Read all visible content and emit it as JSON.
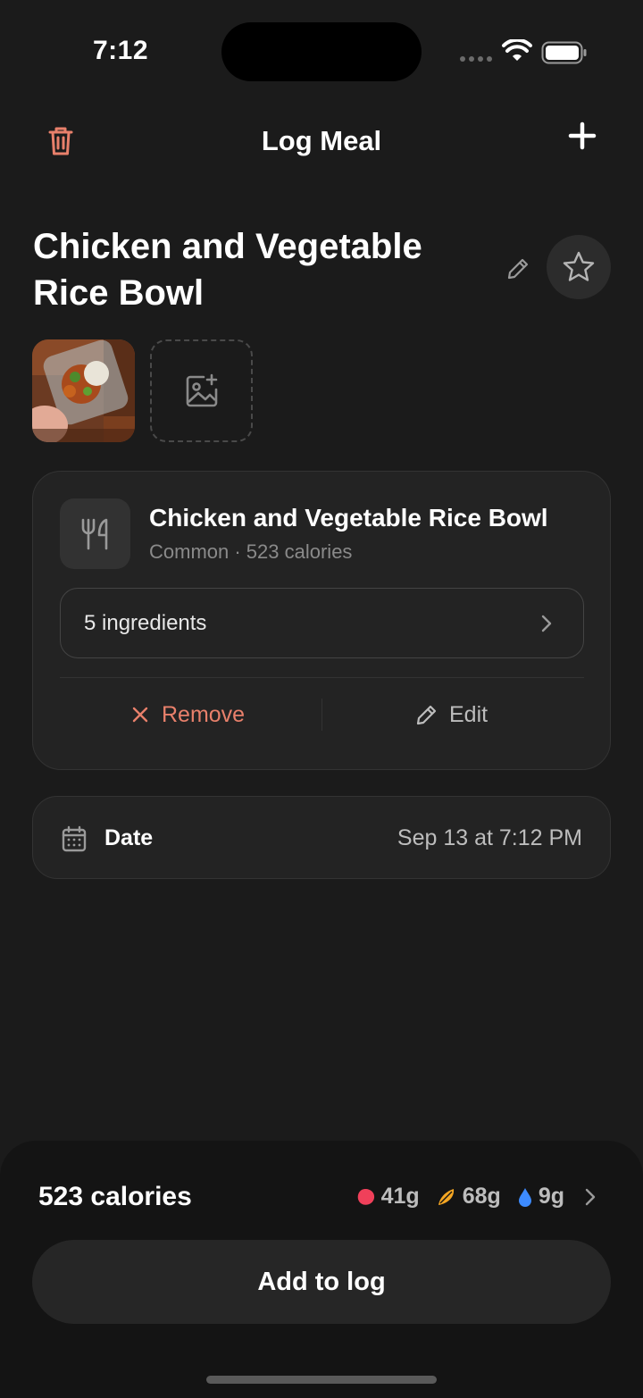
{
  "status_bar": {
    "time": "7:12"
  },
  "nav": {
    "title": "Log Meal"
  },
  "meal": {
    "title": "Chicken and Vegetable Rice Bowl"
  },
  "food_item": {
    "name": "Chicken and Vegetable Rice Bowl",
    "subtitle": "Common · 523 calories",
    "ingredients_label": "5 ingredients",
    "remove_label": "Remove",
    "edit_label": "Edit"
  },
  "date": {
    "label": "Date",
    "value": "Sep 13 at 7:12 PM"
  },
  "summary": {
    "calories": "523 calories",
    "macros": [
      {
        "name": "protein",
        "value": "41g",
        "color": "#f0405a"
      },
      {
        "name": "carbs",
        "value": "68g",
        "color": "#f5a623"
      },
      {
        "name": "fat",
        "value": "9g",
        "color": "#3d8bff"
      }
    ]
  },
  "actions": {
    "add_to_log": "Add to log"
  },
  "colors": {
    "accent": "#e8806b",
    "background": "#1b1b1b",
    "card": "#232323"
  }
}
